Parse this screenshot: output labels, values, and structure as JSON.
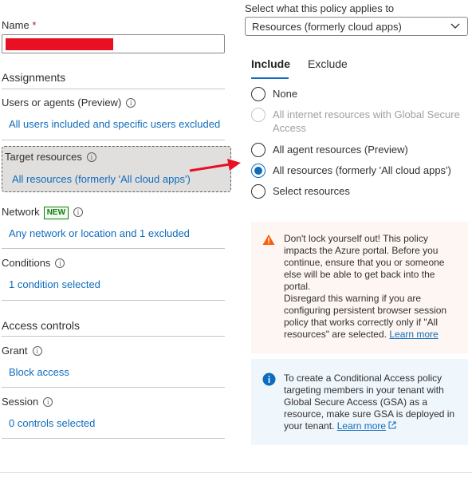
{
  "left": {
    "name_label": "Name",
    "name_required": "*",
    "assignments_heading": "Assignments",
    "users": {
      "label": "Users or agents (Preview)",
      "value": "All users included and specific users excluded"
    },
    "target": {
      "label": "Target resources",
      "value": "All resources (formerly 'All cloud apps')"
    },
    "network": {
      "label": "Network",
      "badge": "NEW",
      "value": "Any network or location and 1 excluded"
    },
    "conditions": {
      "label": "Conditions",
      "value": "1 condition selected"
    },
    "access_controls_heading": "Access controls",
    "grant": {
      "label": "Grant",
      "value": "Block access"
    },
    "session": {
      "label": "Session",
      "value": "0 controls selected"
    }
  },
  "right": {
    "applies_label": "Select what this policy applies to",
    "applies_value": "Resources (formerly cloud apps)",
    "tabs": [
      "Include",
      "Exclude"
    ],
    "active_tab": "Include",
    "options": [
      {
        "label": "None",
        "checked": false,
        "disabled": false
      },
      {
        "label": "All internet resources with Global Secure Access",
        "checked": false,
        "disabled": true
      },
      {
        "label": "All agent resources (Preview)",
        "checked": false,
        "disabled": false
      },
      {
        "label": "All resources (formerly 'All cloud apps')",
        "checked": true,
        "disabled": false
      },
      {
        "label": "Select resources",
        "checked": false,
        "disabled": false
      }
    ],
    "warning": {
      "text1": "Don't lock yourself out! This policy impacts the Azure portal. Before you continue, ensure that you or someone else will be able to get back into the portal.",
      "text2": "Disregard this warning if you are configuring persistent browser session policy that works correctly only if \"All resources\" are selected.",
      "link": "Learn more"
    },
    "info": {
      "text": "To create a Conditional Access policy targeting members in your tenant with Global Secure Access (GSA) as a resource, make sure GSA is deployed in your tenant.",
      "link": "Learn more"
    }
  },
  "colors": {
    "link": "#0f6cbd",
    "warning_bg": "#fdf6f3",
    "info_bg": "#eff6fc",
    "arrow": "#e81123",
    "new_badge": "#107c10"
  }
}
